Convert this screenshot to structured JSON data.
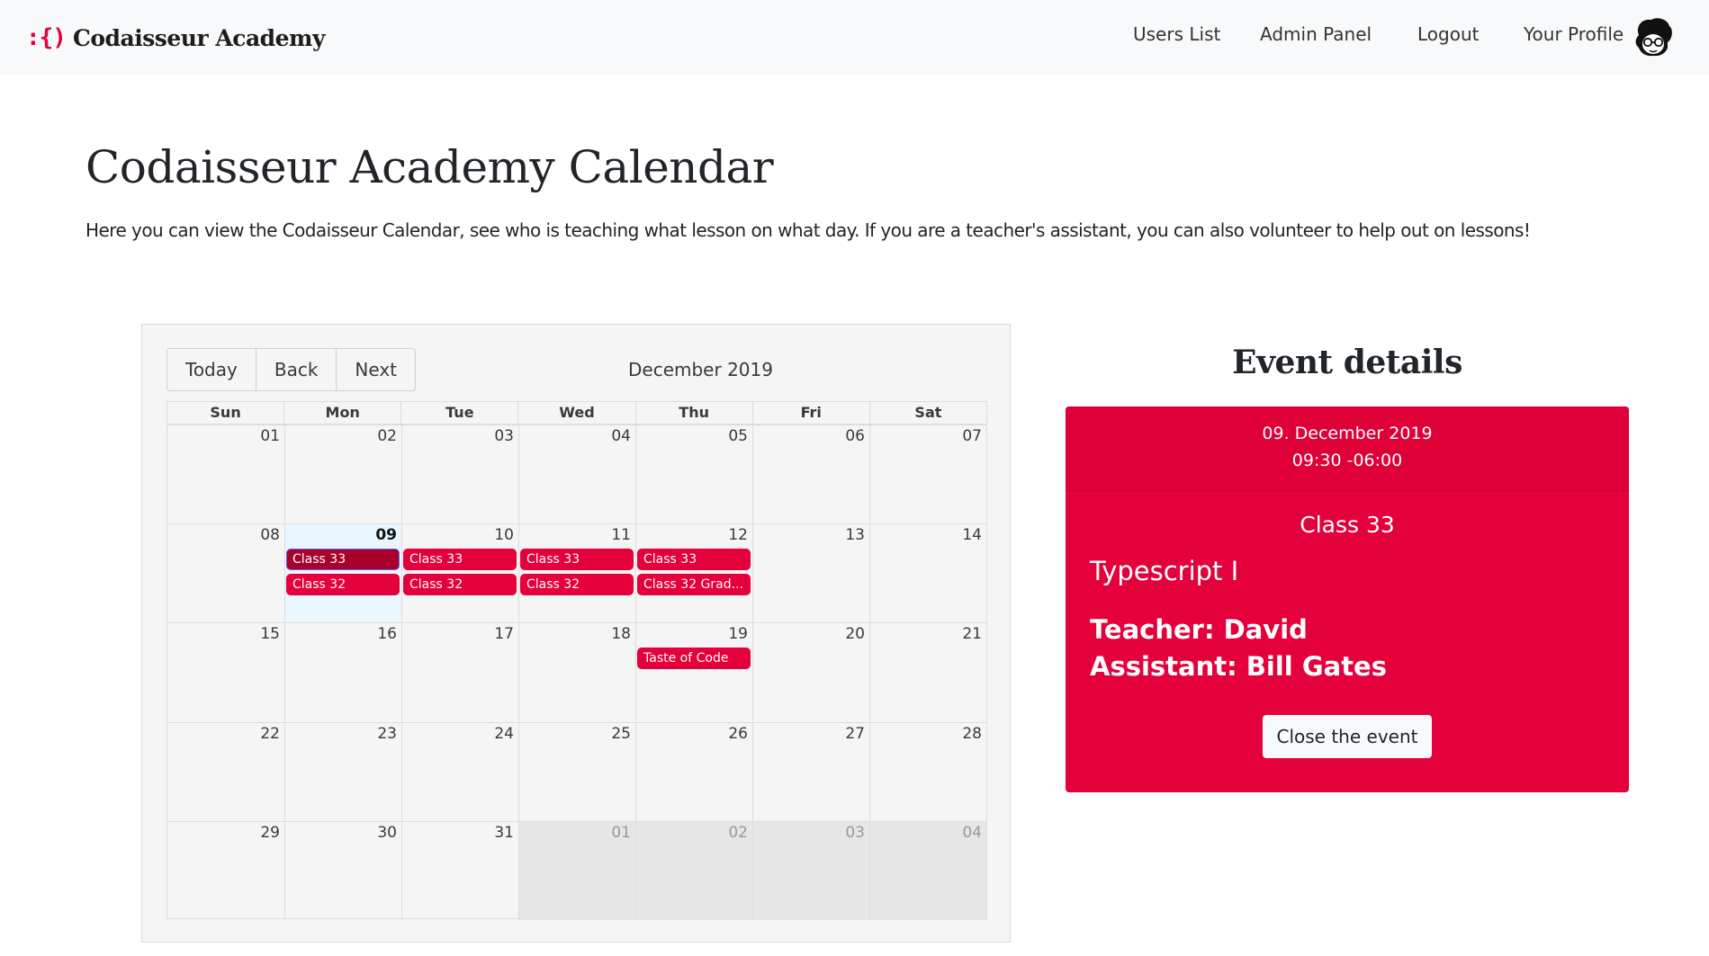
{
  "navbar": {
    "logo_text": ":{)",
    "brand_name": "Codaisseur Academy",
    "links": [
      "Users List",
      "Admin Panel",
      "Logout",
      "Your Profile"
    ]
  },
  "page": {
    "title": "Codaisseur Academy Calendar",
    "description": "Here you can view the Codaisseur Calendar, see who is teaching what lesson on what day. If you are a teacher's assistant, you can also volunteer to help out on lessons!"
  },
  "calendar": {
    "toolbar": {
      "today": "Today",
      "back": "Back",
      "next": "Next",
      "label": "December 2019"
    },
    "weekdays": [
      "Sun",
      "Mon",
      "Tue",
      "Wed",
      "Thu",
      "Fri",
      "Sat"
    ],
    "weeks": [
      {
        "days": [
          "01",
          "02",
          "03",
          "04",
          "05",
          "06",
          "07"
        ],
        "off": [
          false,
          false,
          false,
          false,
          false,
          false,
          false
        ]
      },
      {
        "days": [
          "08",
          "09",
          "10",
          "11",
          "12",
          "13",
          "14"
        ],
        "off": [
          false,
          false,
          false,
          false,
          false,
          false,
          false
        ]
      },
      {
        "days": [
          "15",
          "16",
          "17",
          "18",
          "19",
          "20",
          "21"
        ],
        "off": [
          false,
          false,
          false,
          false,
          false,
          false,
          false
        ]
      },
      {
        "days": [
          "22",
          "23",
          "24",
          "25",
          "26",
          "27",
          "28"
        ],
        "off": [
          false,
          false,
          false,
          false,
          false,
          false,
          false
        ]
      },
      {
        "days": [
          "29",
          "30",
          "31",
          "01",
          "02",
          "03",
          "04"
        ],
        "off": [
          false,
          false,
          false,
          true,
          true,
          true,
          true
        ]
      }
    ],
    "today": {
      "week": 1,
      "day": 1
    },
    "events": [
      {
        "week": 1,
        "day": 1,
        "slot": 0,
        "title": "Class 33",
        "selected": true
      },
      {
        "week": 1,
        "day": 2,
        "slot": 0,
        "title": "Class 33"
      },
      {
        "week": 1,
        "day": 3,
        "slot": 0,
        "title": "Class 33"
      },
      {
        "week": 1,
        "day": 4,
        "slot": 0,
        "title": "Class 33"
      },
      {
        "week": 1,
        "day": 1,
        "slot": 1,
        "title": "Class 32"
      },
      {
        "week": 1,
        "day": 2,
        "slot": 1,
        "title": "Class 32"
      },
      {
        "week": 1,
        "day": 3,
        "slot": 1,
        "title": "Class 32"
      },
      {
        "week": 1,
        "day": 4,
        "slot": 1,
        "title": "Class 32 Grad..."
      },
      {
        "week": 2,
        "day": 4,
        "slot": 0,
        "title": "Taste of Code"
      }
    ]
  },
  "details": {
    "heading": "Event details",
    "date": "09. December 2019",
    "time": "09:30 -06:00",
    "class_name": "Class 33",
    "lesson": "Typescript I",
    "teacher": "Teacher: David",
    "assistant": "Assistant: Bill Gates",
    "close_label": "Close the event"
  },
  "colors": {
    "accent": "#e4003a",
    "selected_event": "#a8002b",
    "today_bg": "#eaf6ff",
    "off_range_bg": "#e6e6e6"
  }
}
